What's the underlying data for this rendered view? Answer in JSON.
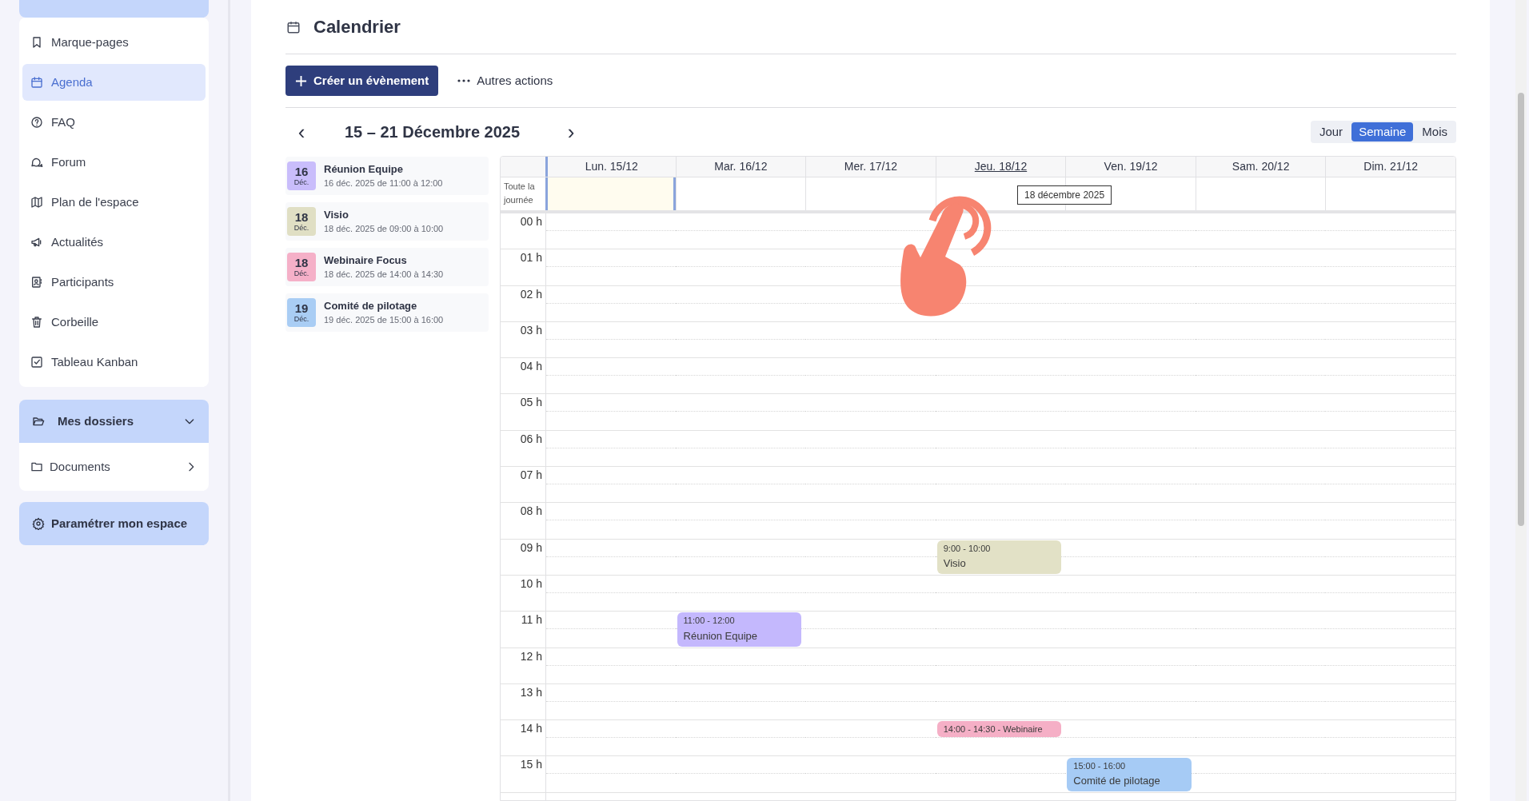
{
  "sidebar": {
    "menu": [
      {
        "label": "Marque-pages",
        "selected": false
      },
      {
        "label": "Agenda",
        "selected": true
      },
      {
        "label": "FAQ",
        "selected": false
      },
      {
        "label": "Forum",
        "selected": false
      },
      {
        "label": "Plan de l'espace",
        "selected": false
      },
      {
        "label": "Actualités",
        "selected": false
      },
      {
        "label": "Participants",
        "selected": false
      },
      {
        "label": "Corbeille",
        "selected": false
      },
      {
        "label": "Tableau Kanban",
        "selected": false
      }
    ],
    "folders": {
      "label": "Mes dossiers",
      "expanded": true,
      "children": [
        {
          "label": "Documents"
        }
      ]
    },
    "settings_button": "Paramétrer mon espace"
  },
  "page": {
    "title": "Calendrier",
    "create_button": "Créer un évènement",
    "more_actions": "Autres actions"
  },
  "navigation": {
    "prev": "‹",
    "range": "15 – 21 Décembre 2025",
    "next": "›",
    "views": [
      {
        "label": "Jour",
        "selected": false
      },
      {
        "label": "Semaine",
        "selected": true
      },
      {
        "label": "Mois",
        "selected": false
      }
    ]
  },
  "upcoming": [
    {
      "day": "16",
      "month": "Déc.",
      "title": "Réunion Equipe",
      "when": "16 déc. 2025 de 11:00 à 12:00",
      "color": "#c9bdfb"
    },
    {
      "day": "18",
      "month": "Déc.",
      "title": "Visio",
      "when": "18 déc. 2025 de 09:00 à 10:00",
      "color": "#e0dfc4"
    },
    {
      "day": "18",
      "month": "Déc.",
      "title": "Webinaire Focus",
      "when": "18 déc. 2025 de 14:00 à 14:30",
      "color": "#f5b0c8"
    },
    {
      "day": "19",
      "month": "Déc.",
      "title": "Comité de pilotage",
      "when": "19 déc. 2025 de 15:00 à 16:00",
      "color": "#a9cdf4"
    }
  ],
  "calendar": {
    "all_day_label": "Toute la journée",
    "columns": [
      {
        "label": "Lun. 15/12",
        "today": true,
        "hovered": false
      },
      {
        "label": "Mar. 16/12",
        "today": false,
        "hovered": false,
        "events": [
          {
            "time": "11:00 - 12:00",
            "title": "Réunion Equipe",
            "color": "#c4b8fd"
          }
        ]
      },
      {
        "label": "Mer. 17/12",
        "today": false,
        "hovered": false
      },
      {
        "label": "Jeu. 18/12",
        "today": false,
        "hovered": true,
        "tooltip": "18 décembre 2025",
        "events": [
          {
            "time": "9:00 - 10:00",
            "title": "Visio",
            "color": "#e2e1c6"
          },
          {
            "time": "14:00 - 14:30 - Webinaire",
            "color": "#f5afc6"
          }
        ]
      },
      {
        "label": "Ven. 19/12",
        "today": false,
        "hovered": false,
        "events": [
          {
            "time": "15:00 - 16:00",
            "title": "Comité de pilotage",
            "color": "#a6cbf5"
          }
        ]
      },
      {
        "label": "Sam. 20/12",
        "today": false,
        "hovered": false
      },
      {
        "label": "Dim. 21/12",
        "today": false,
        "hovered": false
      }
    ],
    "hours": [
      "00 h",
      "01 h",
      "02 h",
      "03 h",
      "04 h",
      "05 h",
      "06 h",
      "07 h",
      "08 h",
      "09 h",
      "10 h",
      "11 h",
      "12 h",
      "13 h",
      "14 h",
      "15 h"
    ]
  }
}
